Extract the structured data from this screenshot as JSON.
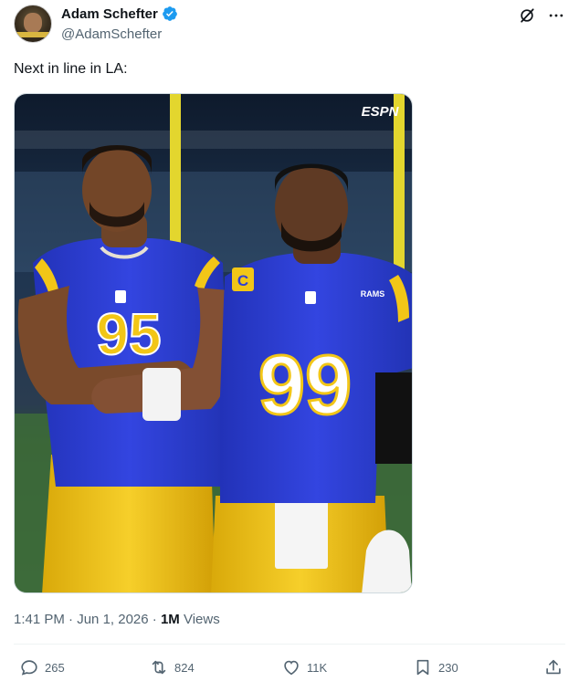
{
  "author": {
    "display_name": "Adam Schefter",
    "handle": "@AdamSchefter"
  },
  "tweet": {
    "text": "Next in line in LA:"
  },
  "media": {
    "watermark": "ESPN",
    "left_player": {
      "jersey_number": "95"
    },
    "right_player": {
      "jersey_number": "99",
      "patch": "C",
      "chest_text": "RAMS"
    }
  },
  "meta": {
    "time": "1:41 PM",
    "date": "Jun 1, 2026",
    "separator": "·",
    "views_count": "1M",
    "views_label": "Views"
  },
  "actions": {
    "replies": "265",
    "reposts": "824",
    "likes": "11K",
    "bookmarks": "230"
  },
  "colors": {
    "verified_blue": "#1d9bf0",
    "ram_blue": "#2f3fd6",
    "ram_gold": "#f2c617",
    "secondary_text": "#536471"
  },
  "icons": [
    "grok-icon",
    "more-icon",
    "reply-icon",
    "repost-icon",
    "like-icon",
    "bookmark-icon",
    "share-icon",
    "verified-badge-icon"
  ]
}
